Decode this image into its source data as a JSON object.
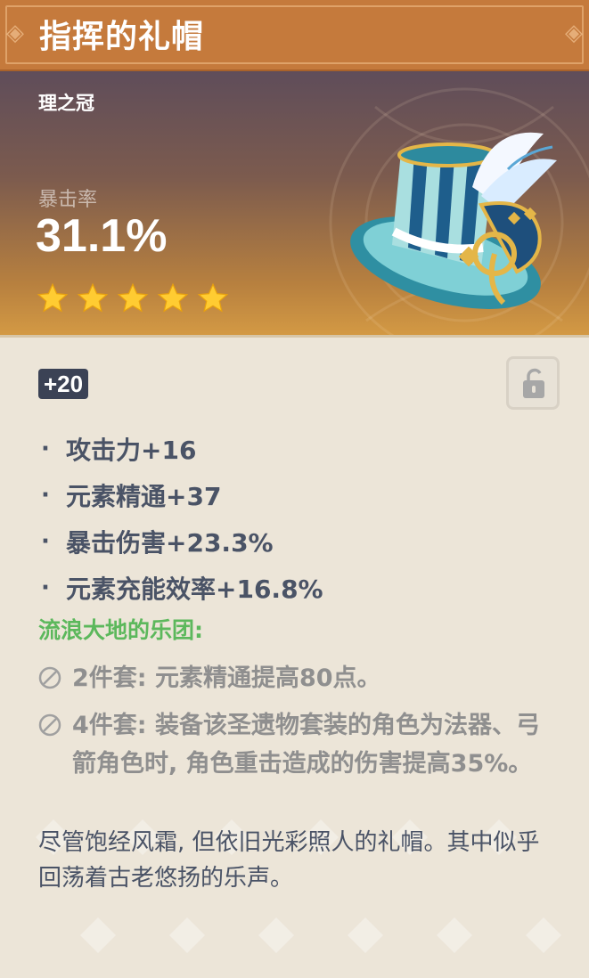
{
  "artifact": {
    "name": "指挥的礼帽",
    "slot": "理之冠",
    "main_stat": {
      "label": "暴击率",
      "value": "31.1%"
    },
    "rarity": 5,
    "level": "+20",
    "locked": false
  },
  "substats": [
    {
      "text": "攻击力+16"
    },
    {
      "text": "元素精通+37"
    },
    {
      "text": "暴击伤害+23.3%"
    },
    {
      "text": "元素充能效率+16.8%"
    }
  ],
  "set": {
    "name": "流浪大地的乐团:",
    "bonus_2": "2件套: 元素精通提高80点。",
    "bonus_4": "4件套: 装备该圣遗物套装的角色为法器、弓箭角色时, 角色重击造成的伤害提高35%。"
  },
  "description": "尽管饱经风霜, 但依旧光彩照人的礼帽。其中似乎回荡着古老悠扬的乐声。",
  "icons": {
    "star": "star-icon",
    "lock": "unlock-icon",
    "ban": "inactive-set-icon"
  },
  "colors": {
    "header": "#c57a3c",
    "star": "#ffcc32",
    "set_name": "#5cb85c",
    "text": "#4a5366",
    "inactive": "#8f8f8f",
    "level_badge": "#3b4255"
  }
}
